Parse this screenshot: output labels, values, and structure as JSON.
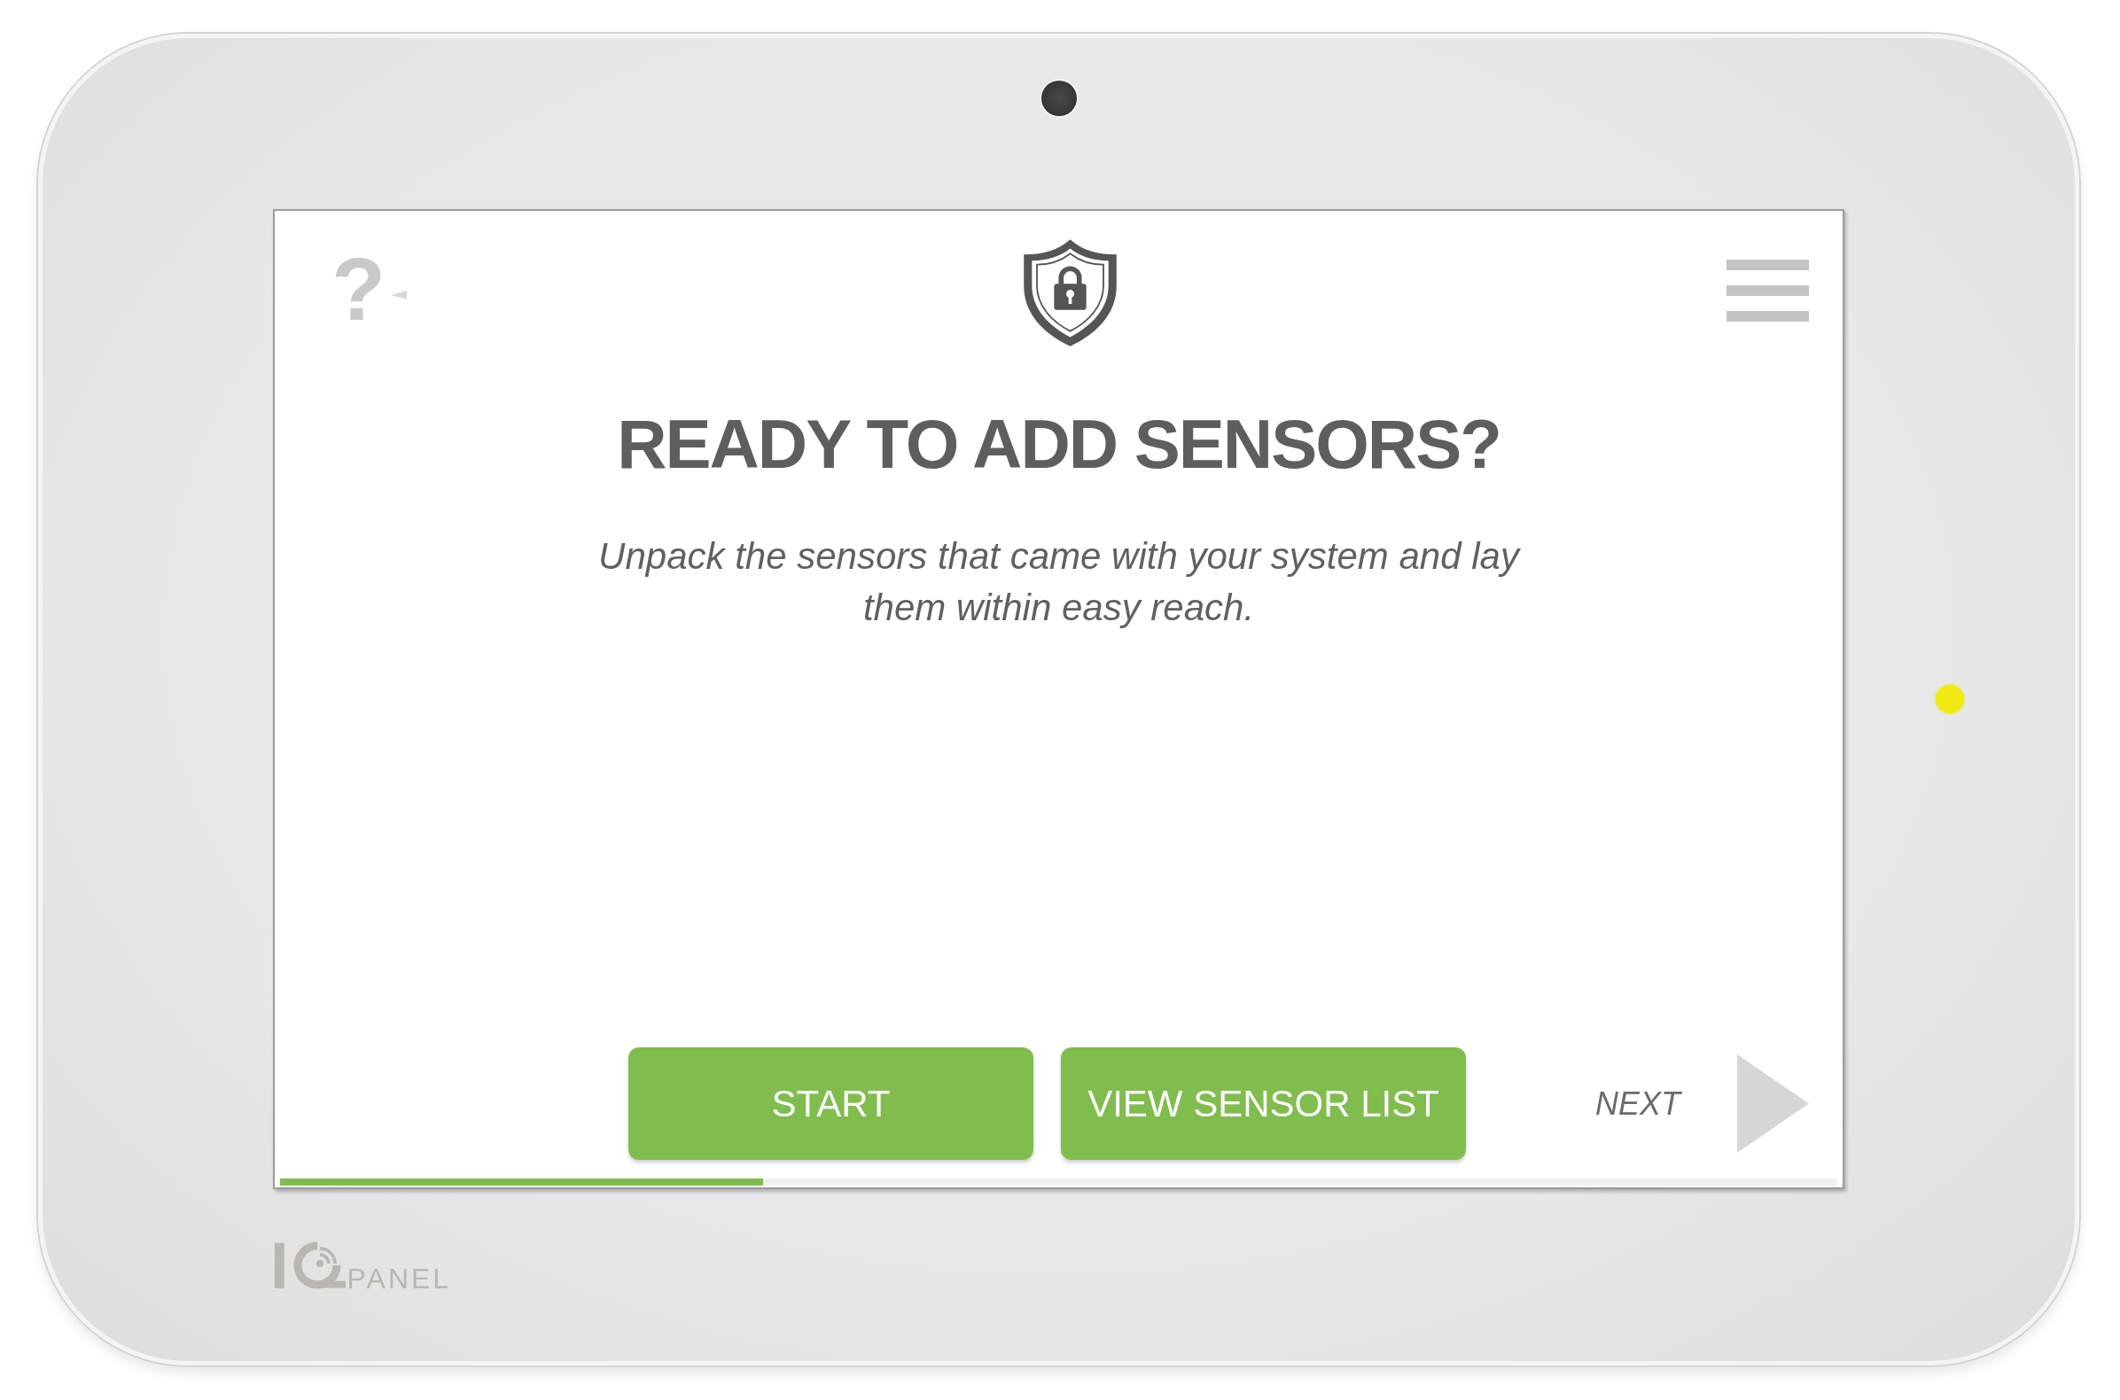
{
  "device": {
    "screen": {
      "help_glyph": "?",
      "title": "READY TO ADD SENSORS?",
      "message": "Unpack the sensors that came with your system and lay them within easy reach.",
      "buttons": [
        {
          "label": "START"
        },
        {
          "label": "VIEW SENSOR LIST"
        }
      ],
      "next_label": "NEXT",
      "progress": {
        "level": 0.31
      }
    },
    "logo": {
      "prefix": "I",
      "suffix": "PANEL"
    }
  }
}
